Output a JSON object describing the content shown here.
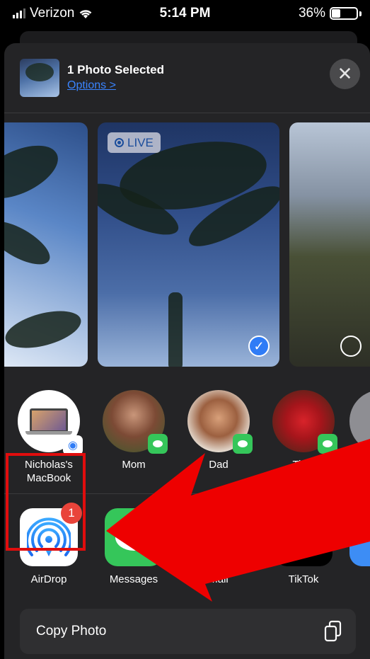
{
  "status_bar": {
    "carrier": "Verizon",
    "time": "5:14 PM",
    "battery": "36%"
  },
  "share_sheet": {
    "title": "1 Photo Selected",
    "options_link": "Options >",
    "close_icon": "x-icon",
    "live_badge": "LIVE",
    "photos": [
      {
        "selected": false
      },
      {
        "live": true,
        "selected": true
      },
      {
        "selected": false
      }
    ],
    "people": [
      {
        "name": "Nicholas's MacBook",
        "badge": "airdrop"
      },
      {
        "name": "Mom",
        "badge": "messages"
      },
      {
        "name": "Dad",
        "badge": "messages"
      },
      {
        "name": "Tit…",
        "badge": "messages"
      }
    ],
    "apps": [
      {
        "label": "AirDrop",
        "badge_count": "1",
        "color": "#ffffff"
      },
      {
        "label": "Messages",
        "color": "#35c65a"
      },
      {
        "label": "Mail",
        "color": "#3d8df5"
      },
      {
        "label": "TikTok",
        "color": "#000000"
      }
    ],
    "actions": [
      {
        "label": "Copy Photo",
        "icon": "copy-icon"
      }
    ]
  },
  "colors": {
    "accent": "#3a84ff",
    "highlight": "#e00d0d",
    "arrow": "#ee0000",
    "sheet": "#242426"
  }
}
